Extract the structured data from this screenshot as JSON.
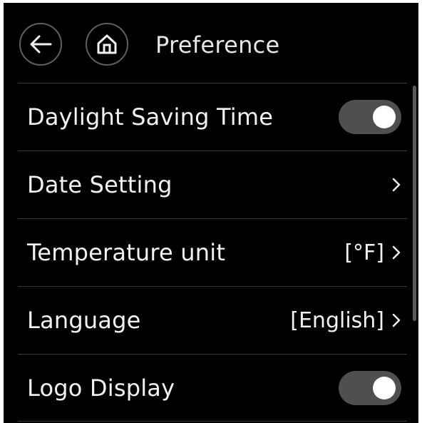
{
  "header": {
    "title": "Preference",
    "back_icon": "arrow-left-icon",
    "home_icon": "home-icon"
  },
  "settings": [
    {
      "label": "Daylight Saving Time",
      "type": "toggle",
      "state": "on"
    },
    {
      "label": "Date Setting",
      "type": "link",
      "value": ""
    },
    {
      "label": "Temperature unit",
      "type": "link",
      "value": "[°F]"
    },
    {
      "label": "Language",
      "type": "link",
      "value": "[English]"
    },
    {
      "label": "Logo Display",
      "type": "toggle",
      "state": "on"
    }
  ],
  "colors": {
    "background": "#000000",
    "text": "#f2f2f2",
    "toggle_track": "#4f4f4f",
    "toggle_knob": "#ffffff",
    "divider": "#3a3a3a"
  },
  "icons": {
    "chevron": "chevron-right-icon"
  }
}
